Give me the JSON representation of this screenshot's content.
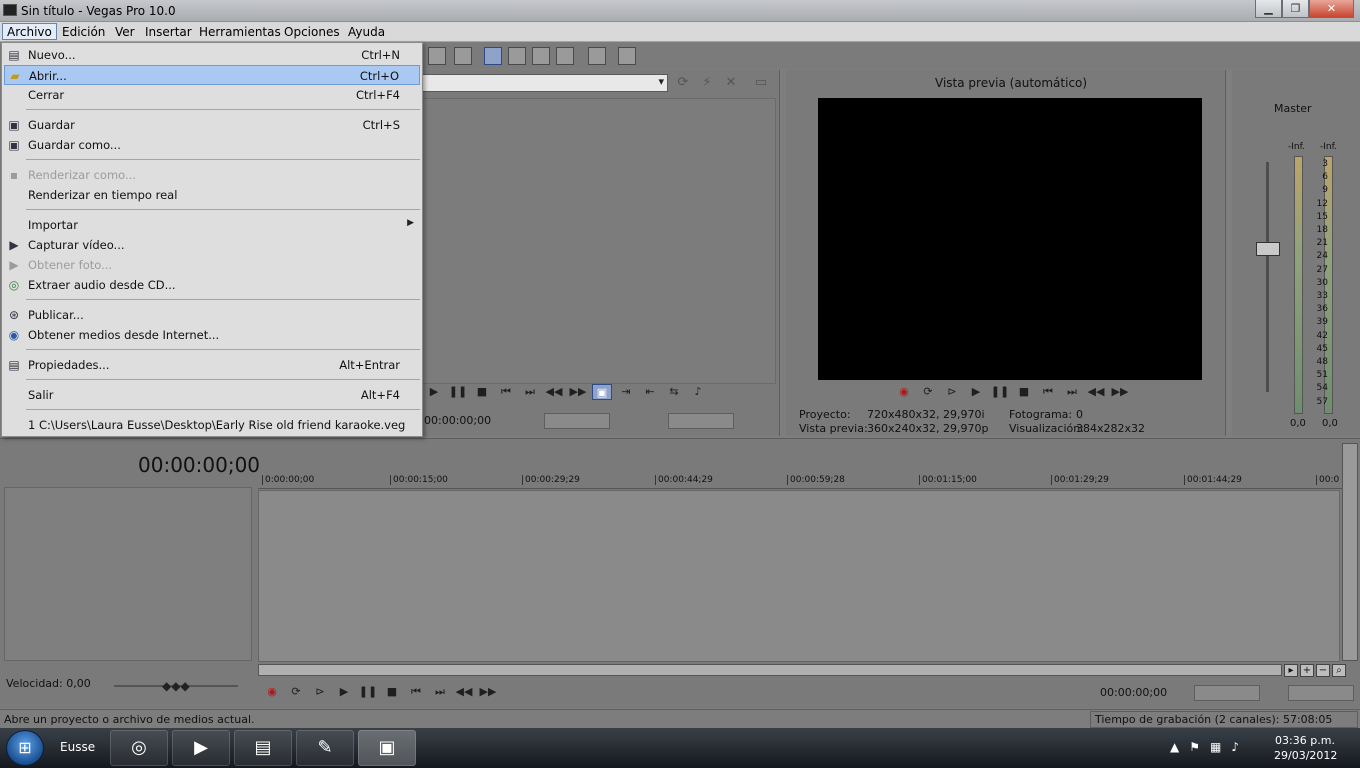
{
  "window": {
    "title": "Sin título - Vegas Pro 10.0",
    "min_icon": "minimize-icon",
    "max_icon": "maximize-icon",
    "close_icon": "close-icon"
  },
  "menubar": [
    "Archivo",
    "Edición",
    "Ver",
    "Insertar",
    "Herramientas",
    "Opciones",
    "Ayuda"
  ],
  "file_menu": {
    "items": [
      {
        "label": "Nuevo...",
        "shortcut": "Ctrl+N",
        "icon": "new-file-icon"
      },
      {
        "label": "Abrir...",
        "shortcut": "Ctrl+O",
        "icon": "open-folder-icon",
        "highlighted": true
      },
      {
        "label": "Cerrar",
        "shortcut": "Ctrl+F4"
      },
      {
        "label": "Guardar",
        "shortcut": "Ctrl+S",
        "icon": "save-icon"
      },
      {
        "label": "Guardar como...",
        "shortcut": "",
        "icon": "save-as-icon"
      },
      {
        "label": "Renderizar como...",
        "shortcut": "",
        "icon": "render-icon",
        "disabled": true
      },
      {
        "label": "Renderizar en tiempo real",
        "shortcut": ""
      },
      {
        "label": "Importar",
        "shortcut": "",
        "submenu": true
      },
      {
        "label": "Capturar vídeo...",
        "shortcut": "",
        "icon": "capture-video-icon"
      },
      {
        "label": "Obtener foto...",
        "shortcut": "",
        "icon": "camera-icon",
        "disabled": true
      },
      {
        "label": "Extraer audio desde CD...",
        "shortcut": "",
        "icon": "cd-icon"
      },
      {
        "label": "Publicar...",
        "shortcut": "",
        "icon": "publish-icon"
      },
      {
        "label": "Obtener medios desde Internet...",
        "shortcut": "",
        "icon": "internet-search-icon"
      },
      {
        "label": "Propiedades...",
        "shortcut": "Alt+Entrar",
        "icon": "properties-icon"
      },
      {
        "label": "Salir",
        "shortcut": "Alt+F4"
      },
      {
        "label": "1 C:\\Users\\Laura Eusse\\Desktop\\Early Rise old friend karaoke.veg",
        "shortcut": ""
      }
    ]
  },
  "explorer": {
    "time": "00:00:00;00"
  },
  "preview": {
    "quality": "Vista previa (automático)",
    "project_label": "Proyecto:",
    "project_value": "720x480x32, 29,970i",
    "preview_label": "Vista previa:",
    "preview_value": "360x240x32, 29,970p",
    "frame_label": "Fotograma:",
    "frame_value": "0",
    "display_label": "Visualización:",
    "display_value": "384x282x32"
  },
  "mixer": {
    "title": "Master",
    "peak_left": "-Inf.",
    "peak_right": "-Inf.",
    "scale": [
      "3",
      "6",
      "9",
      "12",
      "15",
      "18",
      "21",
      "24",
      "27",
      "30",
      "33",
      "36",
      "39",
      "42",
      "45",
      "48",
      "51",
      "54",
      "57"
    ],
    "bottom_left": "0,0",
    "bottom_right": "0,0"
  },
  "timeline": {
    "time": "00:00:00;00",
    "ruler": [
      "0:00:00;00",
      "00:00:15;00",
      "00:00:29;29",
      "00:00:44;29",
      "00:00:59;28",
      "00:01:15;00",
      "00:01:29;29",
      "00:01:44;29",
      "00:0"
    ],
    "speed": "Velocidad: 0,00",
    "cursor_time": "00:00:00;00"
  },
  "status": {
    "message": "Abre un proyecto o archivo de medios actual.",
    "record_time": "Tiempo de grabación (2 canales): 57:08:05"
  },
  "taskbar": {
    "user": "Eusse",
    "time": "03:36 p.m.",
    "date": "29/03/2012"
  }
}
